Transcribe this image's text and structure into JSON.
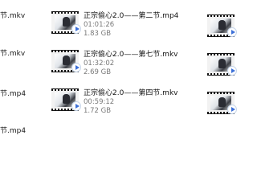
{
  "left_column": [
    {
      "text": "节.mkv"
    },
    {
      "text": "节.mkv"
    },
    {
      "text": "节.mp4"
    },
    {
      "text": "节.mp4"
    }
  ],
  "files": [
    {
      "name": "正宗偷心2.0——第二节.mp4",
      "duration": "01:01:26",
      "size": "1.83 GB"
    },
    {
      "name": "正宗偷心2.0——第七节.mkv",
      "duration": "01:32:02",
      "size": "2.69 GB"
    },
    {
      "name": "正宗偷心2.0——第四节.mkv",
      "duration": "00:59:12",
      "size": "1.72 GB"
    }
  ],
  "icons": {
    "thumbnail": "video-thumbnail-icon",
    "overlay": "play-badge-icon"
  }
}
